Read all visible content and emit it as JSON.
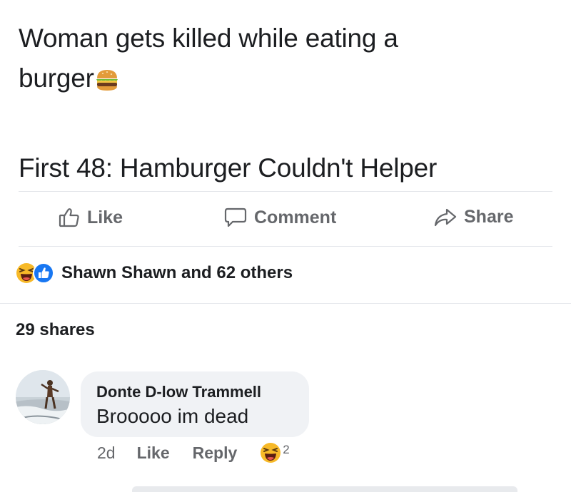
{
  "post": {
    "line1": "Woman gets killed while eating a",
    "line2": "burger",
    "burger_emoji": "burger-emoji",
    "line3": "First 48: Hamburger Couldn't Helper"
  },
  "actions": {
    "like_label": "Like",
    "comment_label": "Comment",
    "share_label": "Share"
  },
  "reactions": {
    "icons": [
      "laughing-reaction-icon",
      "like-reaction-icon"
    ],
    "summary": "Shawn Shawn and 62 others"
  },
  "shares": {
    "label": "29 shares"
  },
  "comment": {
    "author": "Donte D-low Trammell",
    "text": "Brooooo im dead",
    "time": "2d",
    "like_label": "Like",
    "reply_label": "Reply",
    "reaction_icon": "laughing-reaction-icon",
    "reaction_count": "2"
  },
  "colors": {
    "text_primary": "#1c1e21",
    "text_secondary": "#65676b",
    "bubble_bg": "#f0f2f5",
    "divider": "#e4e6eb",
    "like_blue": "#1877f2",
    "haha_yellow": "#f7b928"
  }
}
